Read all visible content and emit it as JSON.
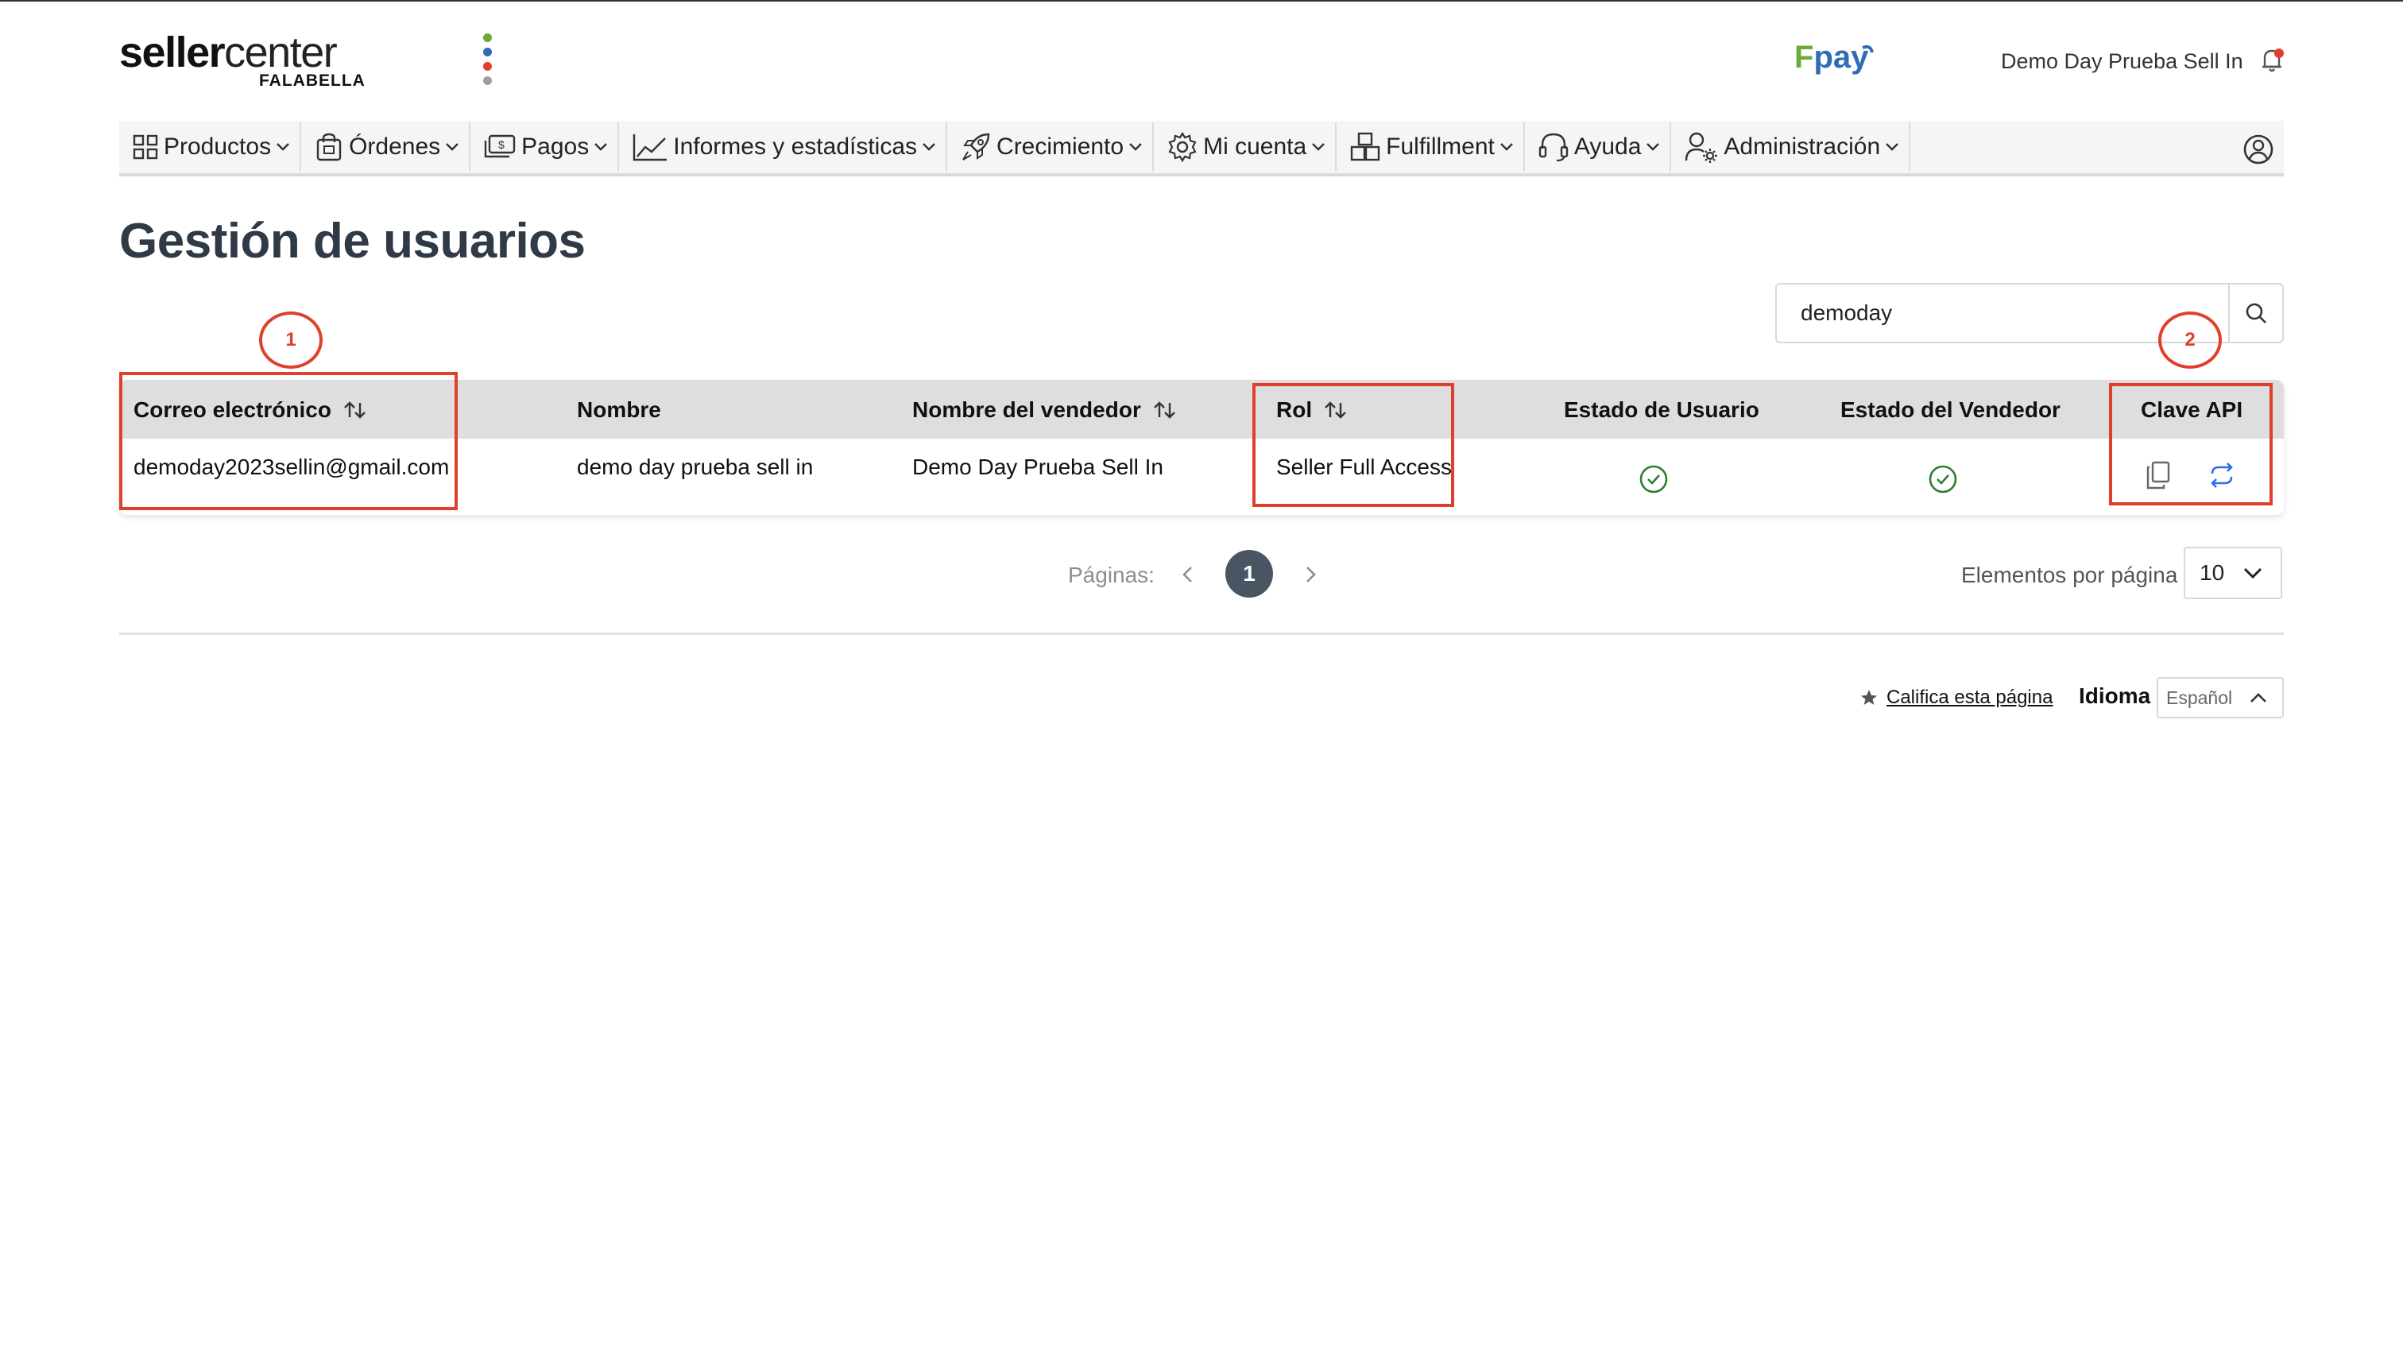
{
  "header": {
    "logo_text_light": "seller",
    "logo_text_center": "center",
    "logo_sub": "FALABELLA",
    "logo_dot_colors": [
      "#6cab3a",
      "#2f6cb5",
      "#e0402b",
      "#9aa0a6"
    ],
    "fpay_f": "F",
    "fpay_rest": "pay",
    "user_name": "Demo Day Prueba Sell In"
  },
  "nav": {
    "items": [
      {
        "label": "Productos",
        "icon": "grid-icon"
      },
      {
        "label": "Órdenes",
        "icon": "shopping-bag-icon"
      },
      {
        "label": "Pagos",
        "icon": "money-icon"
      },
      {
        "label": "Informes y estadísticas",
        "icon": "chart-line-icon"
      },
      {
        "label": "Crecimiento",
        "icon": "rocket-icon"
      },
      {
        "label": "Mi cuenta",
        "icon": "gear-icon"
      },
      {
        "label": "Fulfillment",
        "icon": "boxes-icon"
      },
      {
        "label": "Ayuda",
        "icon": "headset-icon"
      },
      {
        "label": "Administración",
        "icon": "user-gear-icon"
      }
    ]
  },
  "page": {
    "title": "Gestión de usuarios"
  },
  "search": {
    "value": "demoday"
  },
  "table": {
    "headers": {
      "email": "Correo electrónico",
      "name": "Nombre",
      "seller_name": "Nombre del vendedor",
      "role": "Rol",
      "user_status": "Estado de Usuario",
      "seller_status": "Estado del Vendedor",
      "api_key": "Clave API"
    },
    "rows": [
      {
        "email": "demoday2023sellin@gmail.com",
        "name": "demo day prueba sell in",
        "seller_name": "Demo Day Prueba Sell In",
        "role": "Seller Full Access",
        "user_status": "active",
        "seller_status": "active"
      }
    ]
  },
  "annotations": {
    "marker_1": "1",
    "marker_2": "2",
    "color": "#e0402b"
  },
  "pagination": {
    "label": "Páginas:",
    "current_page": "1",
    "per_page_label": "Elementos por página",
    "per_page_value": "10"
  },
  "footer": {
    "rate_link": "Califica esta página",
    "language_label": "Idioma",
    "language_value": "Español"
  },
  "colors": {
    "accent_dark": "#4a5563",
    "success_green": "#2e7d32",
    "api_blue": "#2f6cf0"
  }
}
